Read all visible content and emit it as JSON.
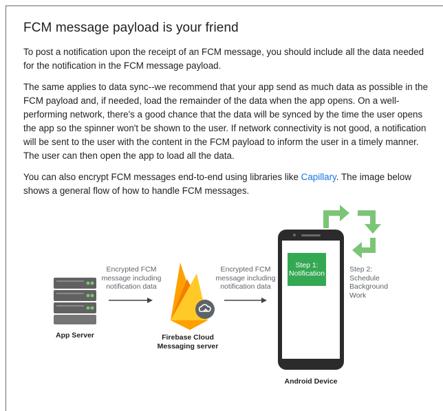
{
  "article": {
    "title": "FCM message payload is your friend",
    "p1": "To post a notification upon the receipt of an FCM message, you should include all the data needed for the notification in the FCM message payload.",
    "p2": "The same applies to data sync--we recommend that your app send as much data as possible in the FCM payload and, if needed, load the remainder of the data when the app opens. On a well-performing network, there's a good chance that the data will be synced by the time the user opens the app so the spinner won't be shown to the user. If network connectivity is not good, a notification will be sent to the user with the content in the FCM payload to inform the user in a timely manner. The user can then open the app to load all the data.",
    "p3_before": "You can also encrypt FCM messages end-to-end using libraries like ",
    "p3_link": "Capillary",
    "p3_after": ". The image below shows a general flow of how to handle FCM messages."
  },
  "diagram": {
    "arrow1_label": "Encrypted FCM\nmessage including\nnotification data",
    "arrow2_label": "Encrypted FCM\nmessage including\nnotification data",
    "app_server": "App Server",
    "fcm_server": "Firebase Cloud\nMessaging server",
    "device": "Android Device",
    "step1": "Step 1:\nNotification",
    "step2": "Step 2:\nSchedule\nBackground\nWork"
  },
  "colors": {
    "link": "#1a73e8",
    "green": "#34a853",
    "light_green": "#7cc576",
    "firebase_yellow": "#ffca28",
    "firebase_orange": "#f57c00",
    "server_gray": "#5f6368"
  }
}
